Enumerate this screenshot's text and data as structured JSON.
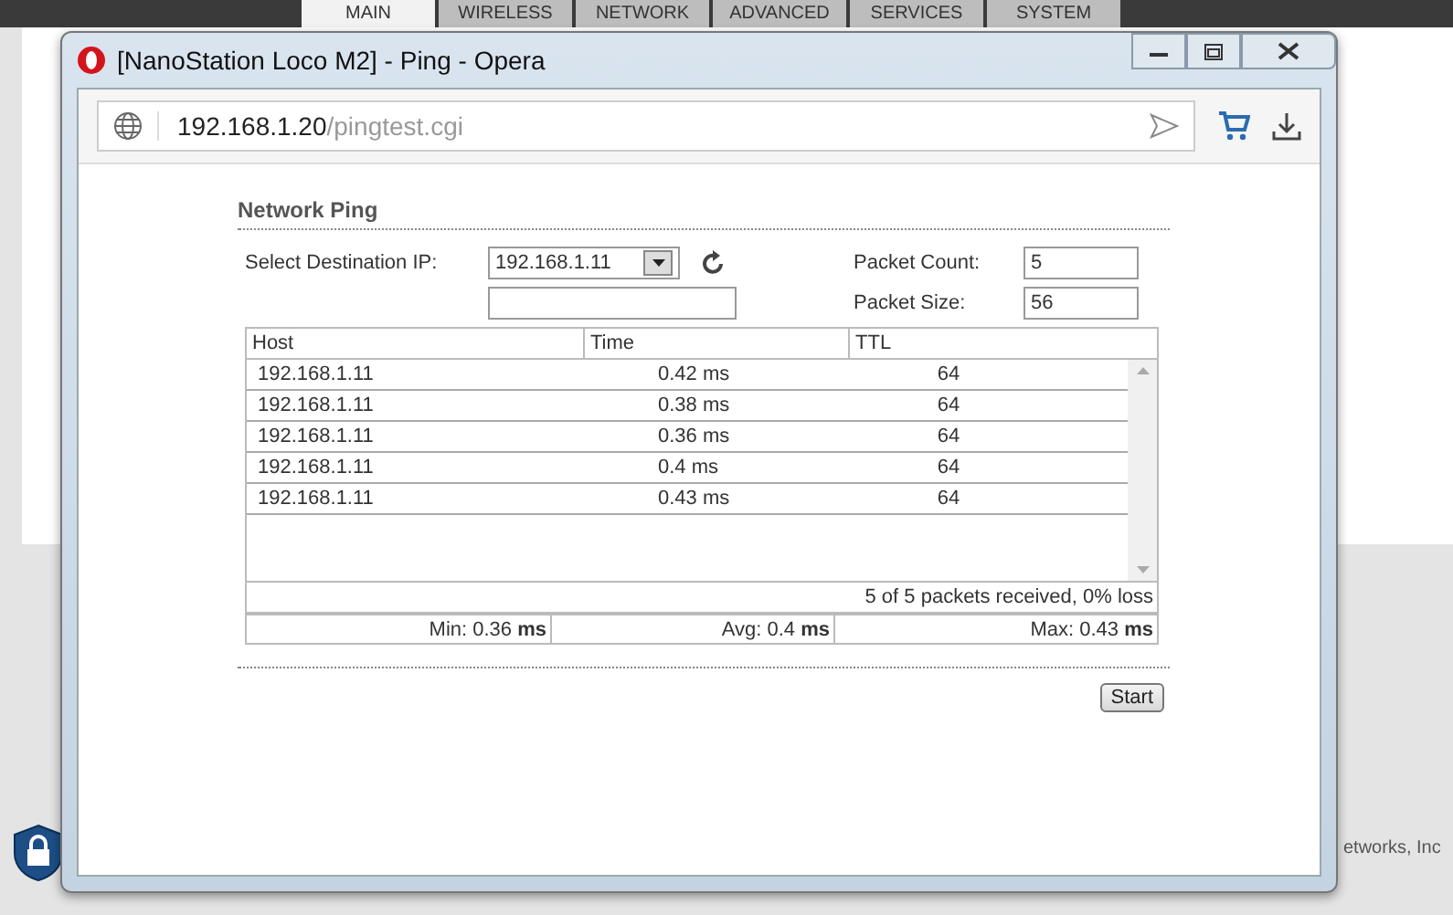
{
  "background": {
    "tabs": [
      {
        "label": "MAIN",
        "selected": true
      },
      {
        "label": "WIRELESS",
        "selected": false
      },
      {
        "label": "NETWORK",
        "selected": false
      },
      {
        "label": "ADVANCED",
        "selected": false
      },
      {
        "label": "SERVICES",
        "selected": false
      },
      {
        "label": "SYSTEM",
        "selected": false
      }
    ],
    "footer": "etworks, Inc"
  },
  "window": {
    "title": "[NanoStation Loco M2] - Ping - Opera",
    "address_host": "192.168.1.20",
    "address_path": "/pingtest.cgi"
  },
  "page": {
    "heading": "Network Ping",
    "destination": {
      "label": "Select Destination IP:",
      "value": "192.168.1.11"
    },
    "packet_count": {
      "label": "Packet Count:",
      "value": "5"
    },
    "packet_size": {
      "label": "Packet Size:",
      "value": "56"
    },
    "table": {
      "columns": [
        "Host",
        "Time",
        "TTL"
      ],
      "rows": [
        {
          "host": "192.168.1.11",
          "time": "0.42 ms",
          "ttl": "64"
        },
        {
          "host": "192.168.1.11",
          "time": "0.38 ms",
          "ttl": "64"
        },
        {
          "host": "192.168.1.11",
          "time": "0.36 ms",
          "ttl": "64"
        },
        {
          "host": "192.168.1.11",
          "time": "0.4 ms",
          "ttl": "64"
        },
        {
          "host": "192.168.1.11",
          "time": "0.43 ms",
          "ttl": "64"
        }
      ],
      "summary": "5 of 5 packets received, 0% loss",
      "stats": [
        "Min: 0.36 **ms**",
        "Avg: 0.4 **ms**",
        "Max: 0.43 **ms**"
      ]
    },
    "start_button": "Start"
  }
}
